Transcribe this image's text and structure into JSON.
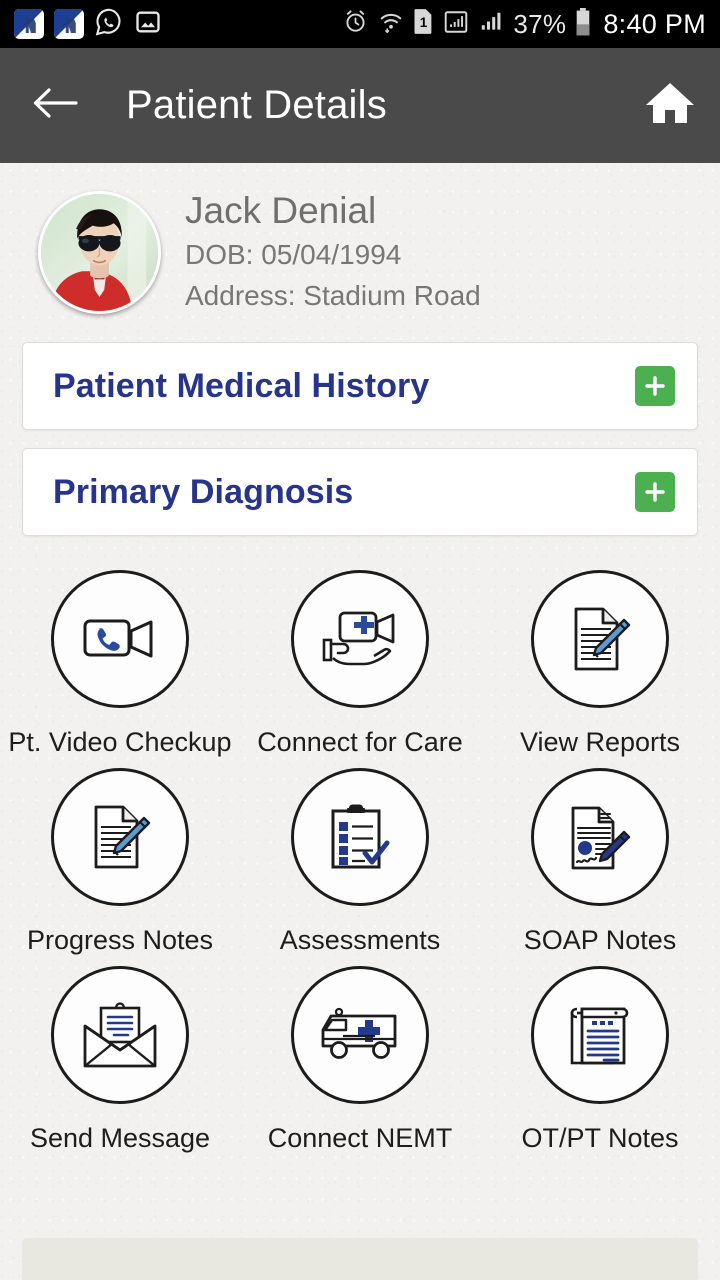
{
  "status_bar": {
    "notification_icons": [
      "app-badge-icon",
      "app-badge-icon",
      "whatsapp-icon",
      "photo-icon"
    ],
    "alarm_icon": "alarm-icon",
    "wifi_icon": "wifi-icon",
    "sim_icon": "sim-1-icon",
    "signal_icon_1": "signal-bars-boxed-icon",
    "signal_icon_2": "signal-bars-icon",
    "battery_percent": "37%",
    "battery_icon": "battery-icon",
    "time": "8:40 PM"
  },
  "app_bar": {
    "back_icon": "arrow-left-icon",
    "title": "Patient Details",
    "home_icon": "home-icon",
    "background_color": "#4a4a4a"
  },
  "patient": {
    "avatar_alt": "patient-photo",
    "name": "Jack Denial",
    "dob": "DOB: 05/04/1994",
    "address": "Address: Stadium Road"
  },
  "cards": [
    {
      "title": "Patient Medical History",
      "action_icon": "plus-icon",
      "action_color": "#4caf50"
    },
    {
      "title": "Primary Diagnosis",
      "action_icon": "plus-icon",
      "action_color": "#4caf50"
    }
  ],
  "actions": [
    {
      "label": "Pt. Video Checkup",
      "icon": "video-call-icon"
    },
    {
      "label": "Connect for Care",
      "icon": "hand-holding-video-care-icon"
    },
    {
      "label": "View Reports",
      "icon": "document-pen-icon"
    },
    {
      "label": "Progress Notes",
      "icon": "document-pen-icon"
    },
    {
      "label": "Assessments",
      "icon": "clipboard-checklist-icon"
    },
    {
      "label": "SOAP Notes",
      "icon": "signed-document-pen-icon"
    },
    {
      "label": "Send Message",
      "icon": "open-envelope-letter-icon"
    },
    {
      "label": "Connect NEMT",
      "icon": "ambulance-icon"
    },
    {
      "label": "OT/PT Notes",
      "icon": "scroll-document-icon"
    }
  ],
  "theme": {
    "accent_blue": "#27348b",
    "accent_green": "#4caf50",
    "background": "#f2f1ef",
    "app_bar": "#4a4a4a",
    "icon_blue": "#2a4a9c"
  }
}
